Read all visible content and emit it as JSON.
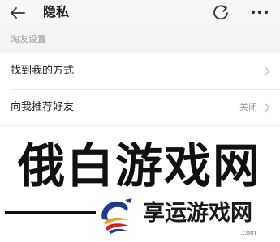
{
  "header": {
    "title": "隐私",
    "back_icon": "arrow-left-icon",
    "refresh_icon": "refresh-icon",
    "more_icon": "more-dots-icon"
  },
  "section": {
    "title": "淘友设置",
    "rows": [
      {
        "label": "找到我的方式",
        "value": ""
      },
      {
        "label": "向我推荐好友",
        "value": "关闭"
      }
    ]
  },
  "watermark": {
    "big_text": "俄白游戏网",
    "text": "享运游戏网",
    "sub": ".com"
  },
  "colors": {
    "header_bg": "#f6f6f6",
    "section_bg": "#f4f4f4",
    "muted_text": "#9a9a9a",
    "logo_blue": "#1f3c8c",
    "logo_orange": "#f19a1e",
    "logo_red": "#d0201a"
  }
}
